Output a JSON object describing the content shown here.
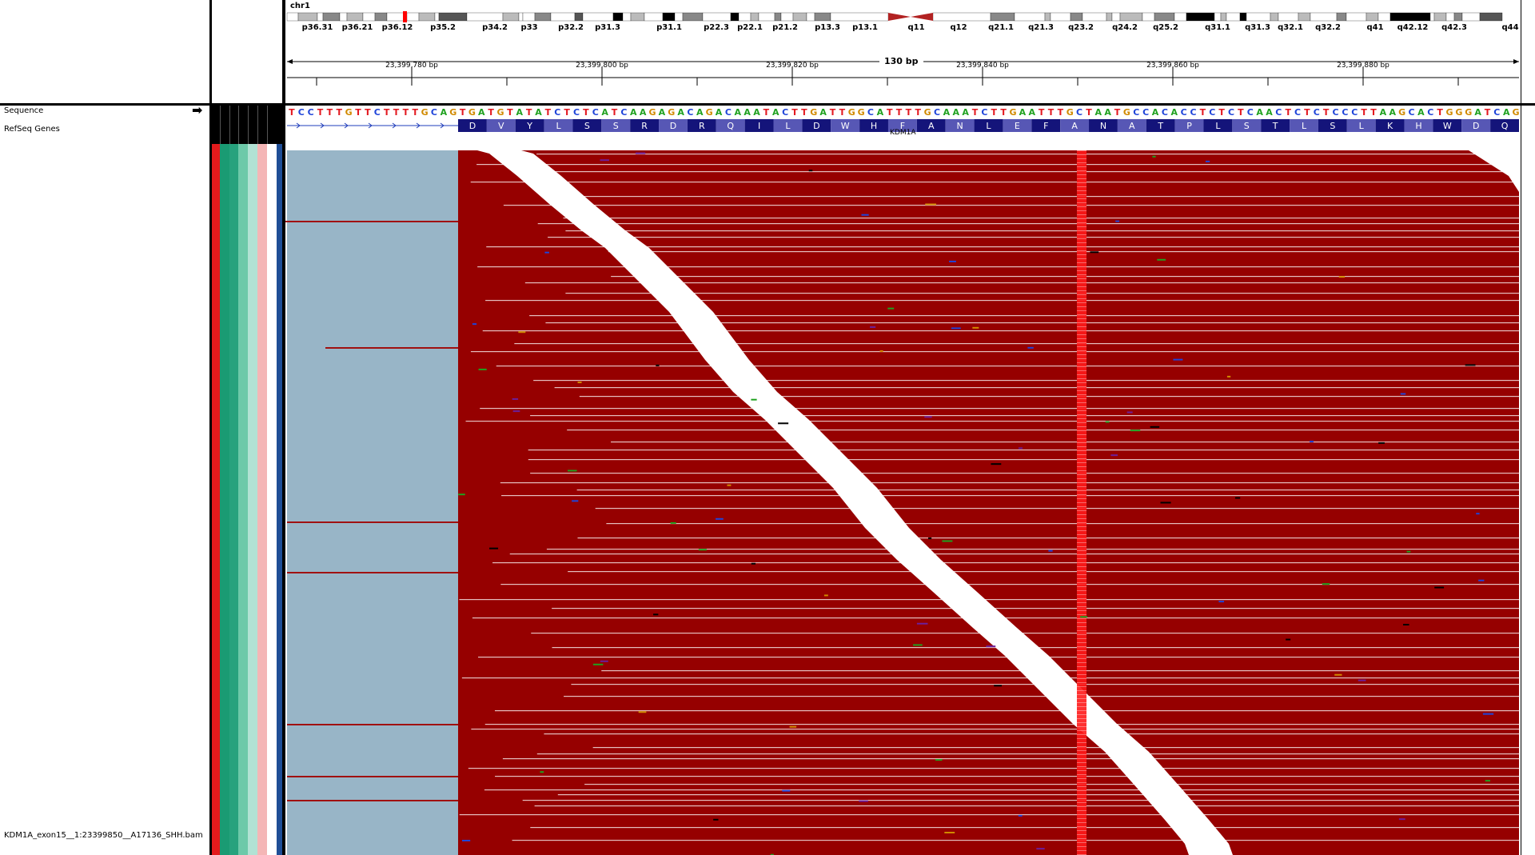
{
  "ideogram": {
    "chromosome": "chr1",
    "bands": [
      "p36.31",
      "p36.21",
      "p36.12",
      "p35.2",
      "p34.2",
      "p33",
      "p32.2",
      "p31.3",
      "p31.1",
      "p22.3",
      "p22.1",
      "p21.2",
      "p13.3",
      "p13.1",
      "q11",
      "q12",
      "q21.1",
      "q21.3",
      "q23.2",
      "q24.2",
      "q25.2",
      "q31.1",
      "q31.3",
      "q32.1",
      "q32.2",
      "q41",
      "q42.12",
      "q42.3",
      "q44"
    ],
    "colors": {
      "gpos100": "#000000",
      "gpos75": "#555555",
      "gpos50": "#888888",
      "gpos25": "#bbbbbb",
      "gneg": "#ffffff",
      "centromere": "#b22222",
      "current_region": "#ff0000"
    }
  },
  "ruler": {
    "span_label": "130 bp",
    "ticks": [
      "23,399,780 bp",
      "23,399,800 bp",
      "23,399,820 bp",
      "23,399,840 bp",
      "23,399,860 bp",
      "23,399,880 bp"
    ]
  },
  "tracks": {
    "sequence_name": "Sequence",
    "genes_name": "RefSeq Genes",
    "bam_name": "KDM1A_exon15__1:23399850__A17136_SHH.bam",
    "strand_arrow": "➡"
  },
  "sequence": "TCCTTTGTTCTTTTGCAGTGATGTATATCTCTCATCAAGAGACAGACAAATACTTGATTGGCATTTTGCAAATCTTGAATTTGCTAATGCCACACCTCTCTCAACTCTCTCCCTTAAGCACTGGGATCAG",
  "gene": {
    "name": "KDM1A",
    "amino_acids": [
      "D",
      "V",
      "Y",
      "L",
      "S",
      "S",
      "R",
      "D",
      "R",
      "Q",
      "I",
      "L",
      "D",
      "W",
      "H",
      "F",
      "A",
      "N",
      "L",
      "E",
      "F",
      "A",
      "N",
      "A",
      "T",
      "P",
      "L",
      "S",
      "T",
      "L",
      "S",
      "L",
      "K",
      "H",
      "W",
      "D",
      "Q"
    ]
  },
  "base_colors": {
    "A": "#1fa11f",
    "C": "#1f44d9",
    "G": "#d18a00",
    "T": "#e3181f"
  },
  "reads": {
    "read_color": "#960000",
    "softclip_color": "#98b5c7",
    "variant_column_color": "#ff1a1a"
  },
  "sidebar_stripes": [
    "#e31a1c",
    "#1a9b73",
    "#27a27d",
    "#6dc9a9",
    "#b2e2d4",
    "#f4b6b6",
    "#ffffff",
    "#1f4e96",
    "#ffffff"
  ]
}
